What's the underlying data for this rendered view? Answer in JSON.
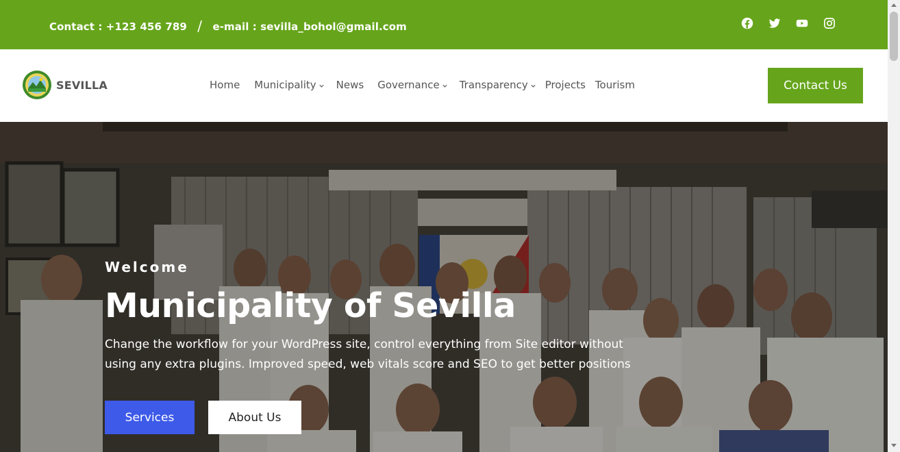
{
  "topbar": {
    "contact_text": "Contact : +123 456 789",
    "separator": "/",
    "email_text": "e-mail : sevilla_bohol@gmail.com",
    "background": "#66a51b",
    "socials": [
      "facebook-icon",
      "twitter-icon",
      "youtube-icon",
      "instagram-icon"
    ]
  },
  "header": {
    "brand": "SEVILLA",
    "logo_icon": "municipal-seal-icon",
    "nav": [
      {
        "label": "Home",
        "has_dropdown": false
      },
      {
        "label": "Municipality",
        "has_dropdown": true
      },
      {
        "label": "News",
        "has_dropdown": false
      },
      {
        "label": "Governance",
        "has_dropdown": true
      },
      {
        "label": "Transparency",
        "has_dropdown": true
      },
      {
        "label": "Projects",
        "has_dropdown": false
      },
      {
        "label": "Tourism",
        "has_dropdown": false
      }
    ],
    "cta_label": "Contact Us",
    "accent": "#66a51b"
  },
  "hero": {
    "eyebrow": "Welcome",
    "title": "Municipality of Sevilla",
    "description": "Change the workflow for your WordPress site, control everything from Site editor without using any extra plugins. Improved speed, web vitals score and SEO to get better positions",
    "primary_button": "Services",
    "secondary_button": "About Us",
    "primary_color": "#3d5ae8"
  }
}
